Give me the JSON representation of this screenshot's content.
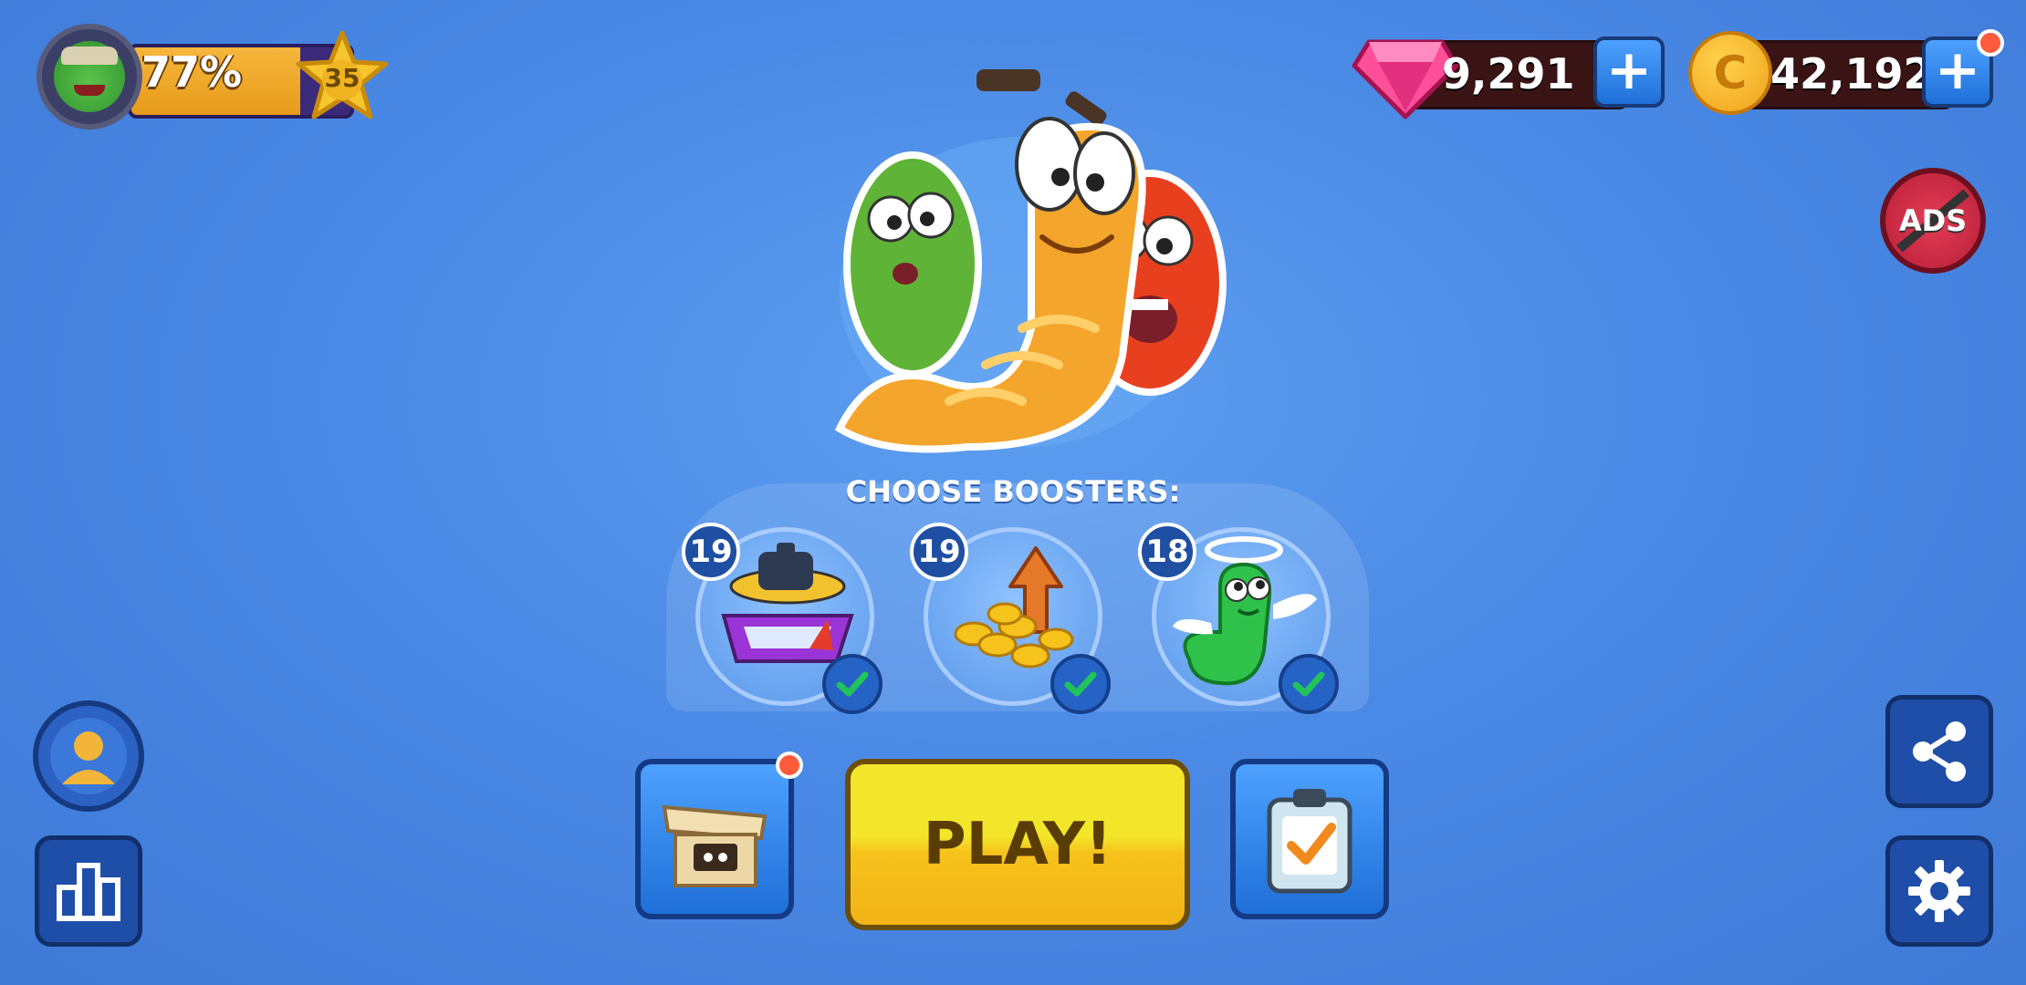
{
  "player": {
    "xp_percent_label": "77%",
    "xp_fill": 0.77,
    "level": "35",
    "avatar_icon": "zombie-worm-avatar-icon"
  },
  "currency": {
    "gems": "9,291",
    "coins": "42,192",
    "gem_icon": "gem-icon",
    "coin_icon": "coin-icon",
    "coin_symbol": "C",
    "plus_label": "+"
  },
  "ads": {
    "label": "ADS"
  },
  "boosters": {
    "title": "CHOOSE BOOSTERS:",
    "items": [
      {
        "name": "weight-scale-booster",
        "count": "19",
        "selected": true
      },
      {
        "name": "coins-boost-booster",
        "count": "19",
        "selected": true
      },
      {
        "name": "angel-worm-booster",
        "count": "18",
        "selected": true
      }
    ]
  },
  "buttons": {
    "play": "PLAY!"
  },
  "colors": {
    "background": "#4a8ae6",
    "play_yellow": "#f3e62a",
    "notification": "#ff5a3c",
    "check_green": "#22c35a"
  }
}
